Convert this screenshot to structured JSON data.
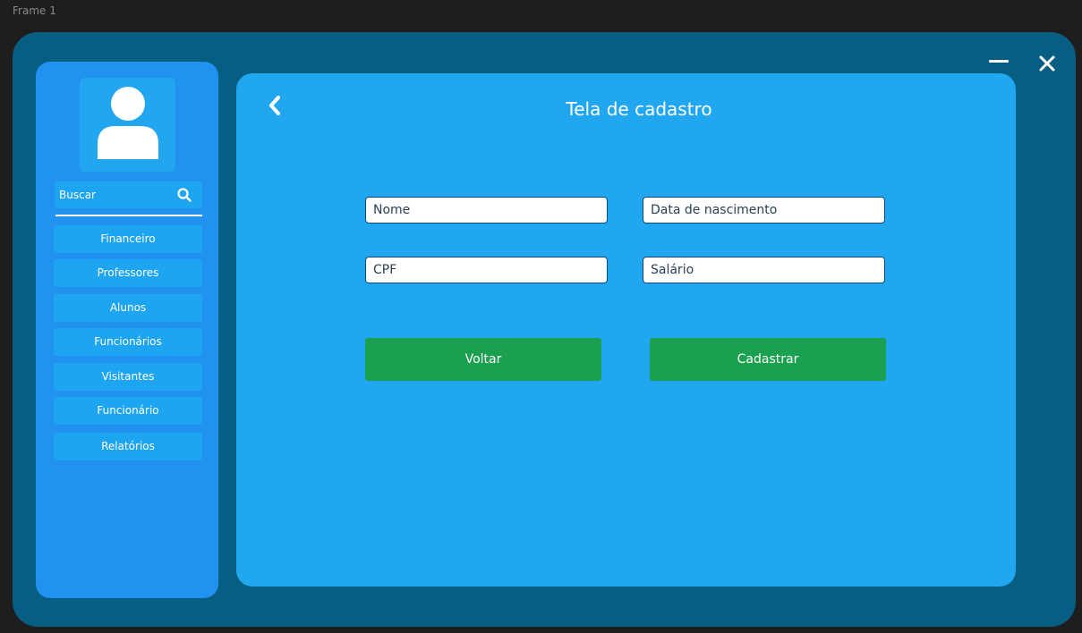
{
  "frame": {
    "label": "Frame 1"
  },
  "window": {
    "minimize_icon": "minus-icon",
    "close_icon": "close-icon"
  },
  "sidebar": {
    "avatar_icon": "user-icon",
    "search": {
      "label": "Buscar",
      "icon": "search-icon"
    },
    "items": [
      {
        "label": "Financeiro"
      },
      {
        "label": "Professores"
      },
      {
        "label": "Alunos"
      },
      {
        "label": "Funcionários"
      },
      {
        "label": "Visitantes"
      },
      {
        "label": "Funcionário"
      },
      {
        "label": "Relatórios"
      }
    ]
  },
  "main": {
    "back_icon": "chevron-left-icon",
    "title": "Tela de cadastro",
    "fields": {
      "nome": {
        "placeholder": "Nome",
        "value": ""
      },
      "data_nascimento": {
        "placeholder": "Data de nascimento",
        "value": ""
      },
      "cpf": {
        "placeholder": "CPF",
        "value": ""
      },
      "salario": {
        "placeholder": "Salário",
        "value": ""
      }
    },
    "buttons": {
      "voltar": "Voltar",
      "cadastrar": "Cadastrar"
    }
  },
  "colors": {
    "background": "#1e1e1e",
    "window": "#075e83",
    "sidebar": "#2292f1",
    "panel": "#21a6f0",
    "nav_item": "#1ea5f1",
    "button": "#1ba04f",
    "text": "#ffffff"
  }
}
